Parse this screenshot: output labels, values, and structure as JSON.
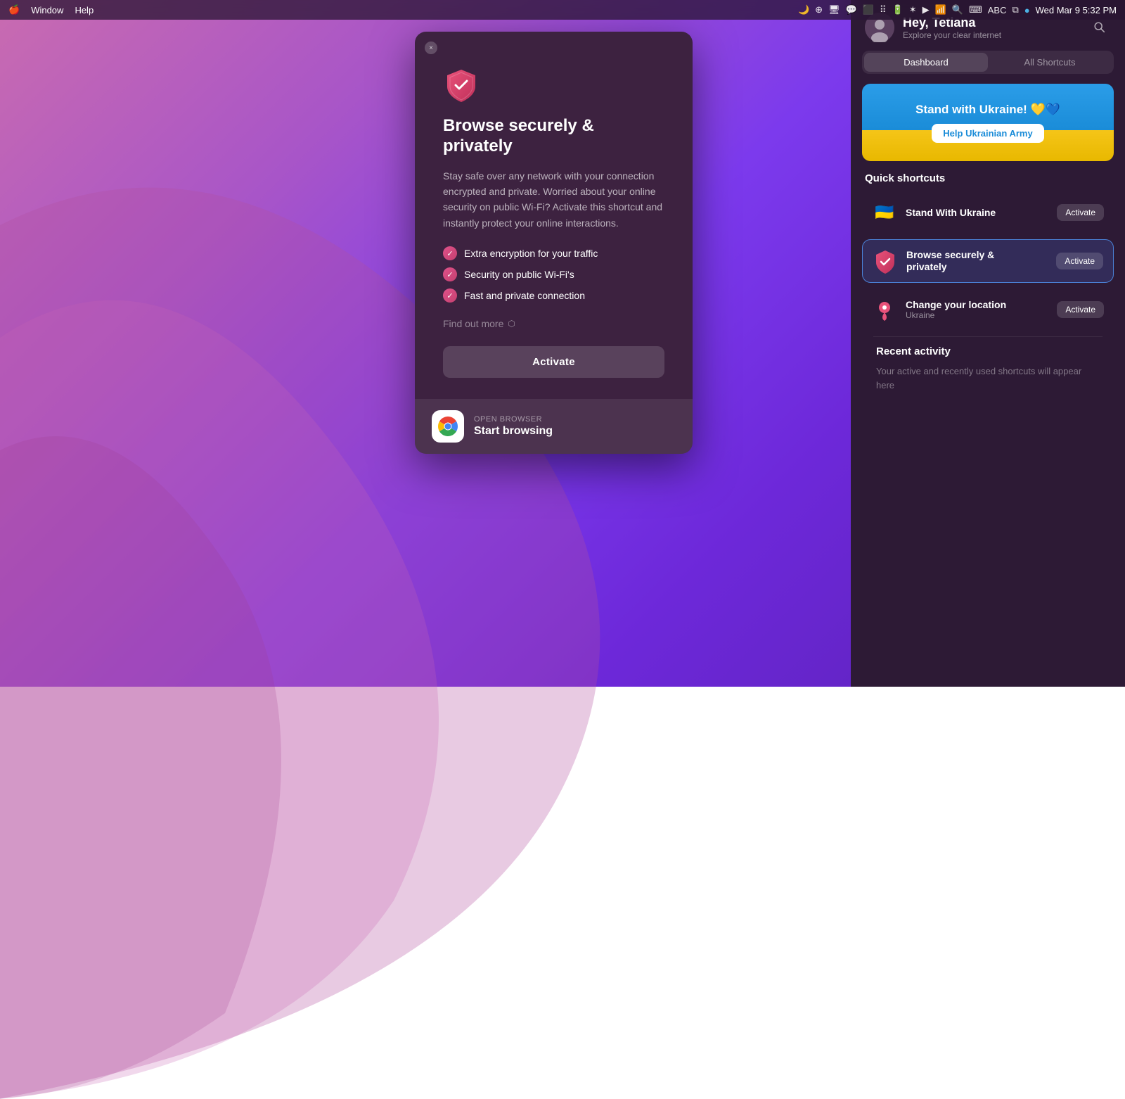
{
  "menubar": {
    "app_window": "Window",
    "app_help": "Help",
    "datetime": "Wed Mar 9  5:32 PM"
  },
  "modal": {
    "close_label": "×",
    "shield_emoji": "🛡",
    "title": "Browse securely & privately",
    "description": "Stay safe over any network with your connection encrypted and private. Worried about your online security on public Wi-Fi? Activate this shortcut and instantly protect your online interactions.",
    "features": [
      "Extra encryption for your traffic",
      "Security on public Wi-Fi's",
      "Fast and private connection"
    ],
    "find_more": "Find out more",
    "activate_label": "Activate",
    "footer": {
      "label": "OPEN BROWSER",
      "title": "Start browsing"
    }
  },
  "panel": {
    "greeting": "Hey, Tetiana",
    "subtitle": "Explore your clear internet",
    "tabs": [
      {
        "label": "Dashboard",
        "active": true
      },
      {
        "label": "All Shortcuts",
        "active": false
      }
    ],
    "ukraine_banner": {
      "title": "Stand with Ukraine! 💛💙",
      "button_label": "Help Ukrainian Army"
    },
    "quick_shortcuts_label": "Quick shortcuts",
    "shortcuts": [
      {
        "name": "Stand With Ukraine",
        "detail": "",
        "icon": "🇺🇦",
        "activate_label": "Activate",
        "highlighted": false
      },
      {
        "name": "Browse securely & privately",
        "detail": "",
        "icon": "shield",
        "activate_label": "Activate",
        "highlighted": true
      },
      {
        "name": "Change your location",
        "detail": "Ukraine",
        "icon": "📍",
        "activate_label": "Activate",
        "highlighted": false
      }
    ],
    "recent_activity_label": "Recent activity",
    "recent_activity_empty": "Your active and recently used shortcuts will appear here"
  }
}
